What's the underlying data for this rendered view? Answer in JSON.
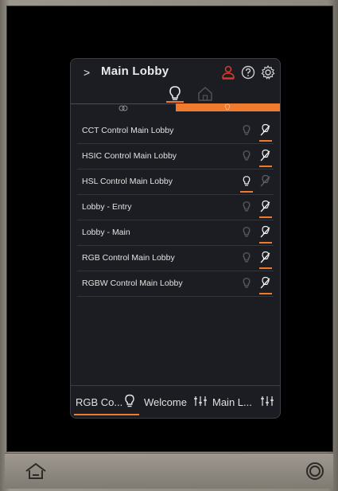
{
  "header": {
    "title": "Main Lobby",
    "back_icon": "chevron-right-icon"
  },
  "view_tabs": [
    {
      "icon": "lightbulb-icon",
      "active": true
    },
    {
      "icon": "house-icon",
      "active": false
    }
  ],
  "subtabs": [
    {
      "icon": "link-icon",
      "active": false
    },
    {
      "icon": "lightbulb-icon",
      "active": true
    }
  ],
  "rows": [
    {
      "label": "CCT Control Main Lobby",
      "selected": "edit"
    },
    {
      "label": "HSIC Control Main Lobby",
      "selected": "edit"
    },
    {
      "label": "HSL Control Main Lobby",
      "selected": "bulb"
    },
    {
      "label": "Lobby - Entry",
      "selected": "edit"
    },
    {
      "label": "Lobby - Main",
      "selected": "edit"
    },
    {
      "label": "RGB Control Main Lobby",
      "selected": "edit"
    },
    {
      "label": "RGBW Control Main Lobby",
      "selected": "edit"
    }
  ],
  "bottom_tabs": [
    {
      "label": "RGB Co...",
      "icon": "lightbulb-icon",
      "active": true
    },
    {
      "label": "Welcome",
      "icon": "sliders-icon",
      "active": false
    },
    {
      "label": "Main L...",
      "icon": "sliders-icon",
      "active": false
    }
  ],
  "colors": {
    "accent": "#ee7b2e",
    "alert": "#d43a2c",
    "panel": "#1b1d22"
  }
}
